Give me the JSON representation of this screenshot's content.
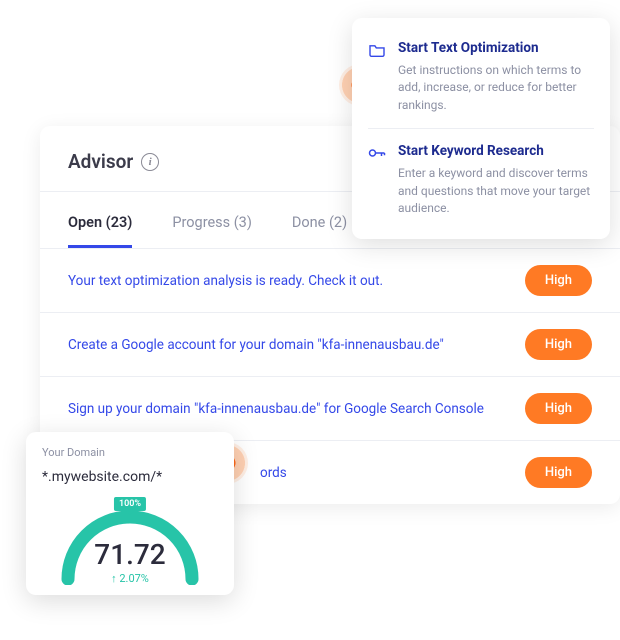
{
  "advisor": {
    "title": "Advisor",
    "tabs": [
      {
        "label": "Open (23)",
        "active": true
      },
      {
        "label": "Progress (3)",
        "active": false
      },
      {
        "label": "Done (2)",
        "active": false
      }
    ],
    "tasks": [
      {
        "text": "Your text optimization analysis is ready. Check it out.",
        "priority": "High"
      },
      {
        "text": "Create a Google account for your domain \"kfa-innenausbau.de\"",
        "priority": "High"
      },
      {
        "text": "Sign up your domain \"kfa-innenausbau.de\" for Google Search Console",
        "priority": "High"
      },
      {
        "text": "ords",
        "priority": "High"
      }
    ]
  },
  "popup": {
    "items": [
      {
        "icon": "folder-icon",
        "title": "Start Text Optimization",
        "desc": "Get instructions on which terms to add, increase, or reduce for better rankings."
      },
      {
        "icon": "key-icon",
        "title": "Start Keyword Research",
        "desc": "Enter a keyword and discover terms and questions that move your target audience."
      }
    ]
  },
  "domain_card": {
    "label": "Your Domain",
    "domain": "*.mywebsite.com/*",
    "gauge": {
      "badge": "100%",
      "value": "71.72",
      "delta": "2.07%"
    }
  },
  "colors": {
    "accent": "#3448e8",
    "pill": "#ff7a24",
    "gauge": "#27c4a8"
  }
}
